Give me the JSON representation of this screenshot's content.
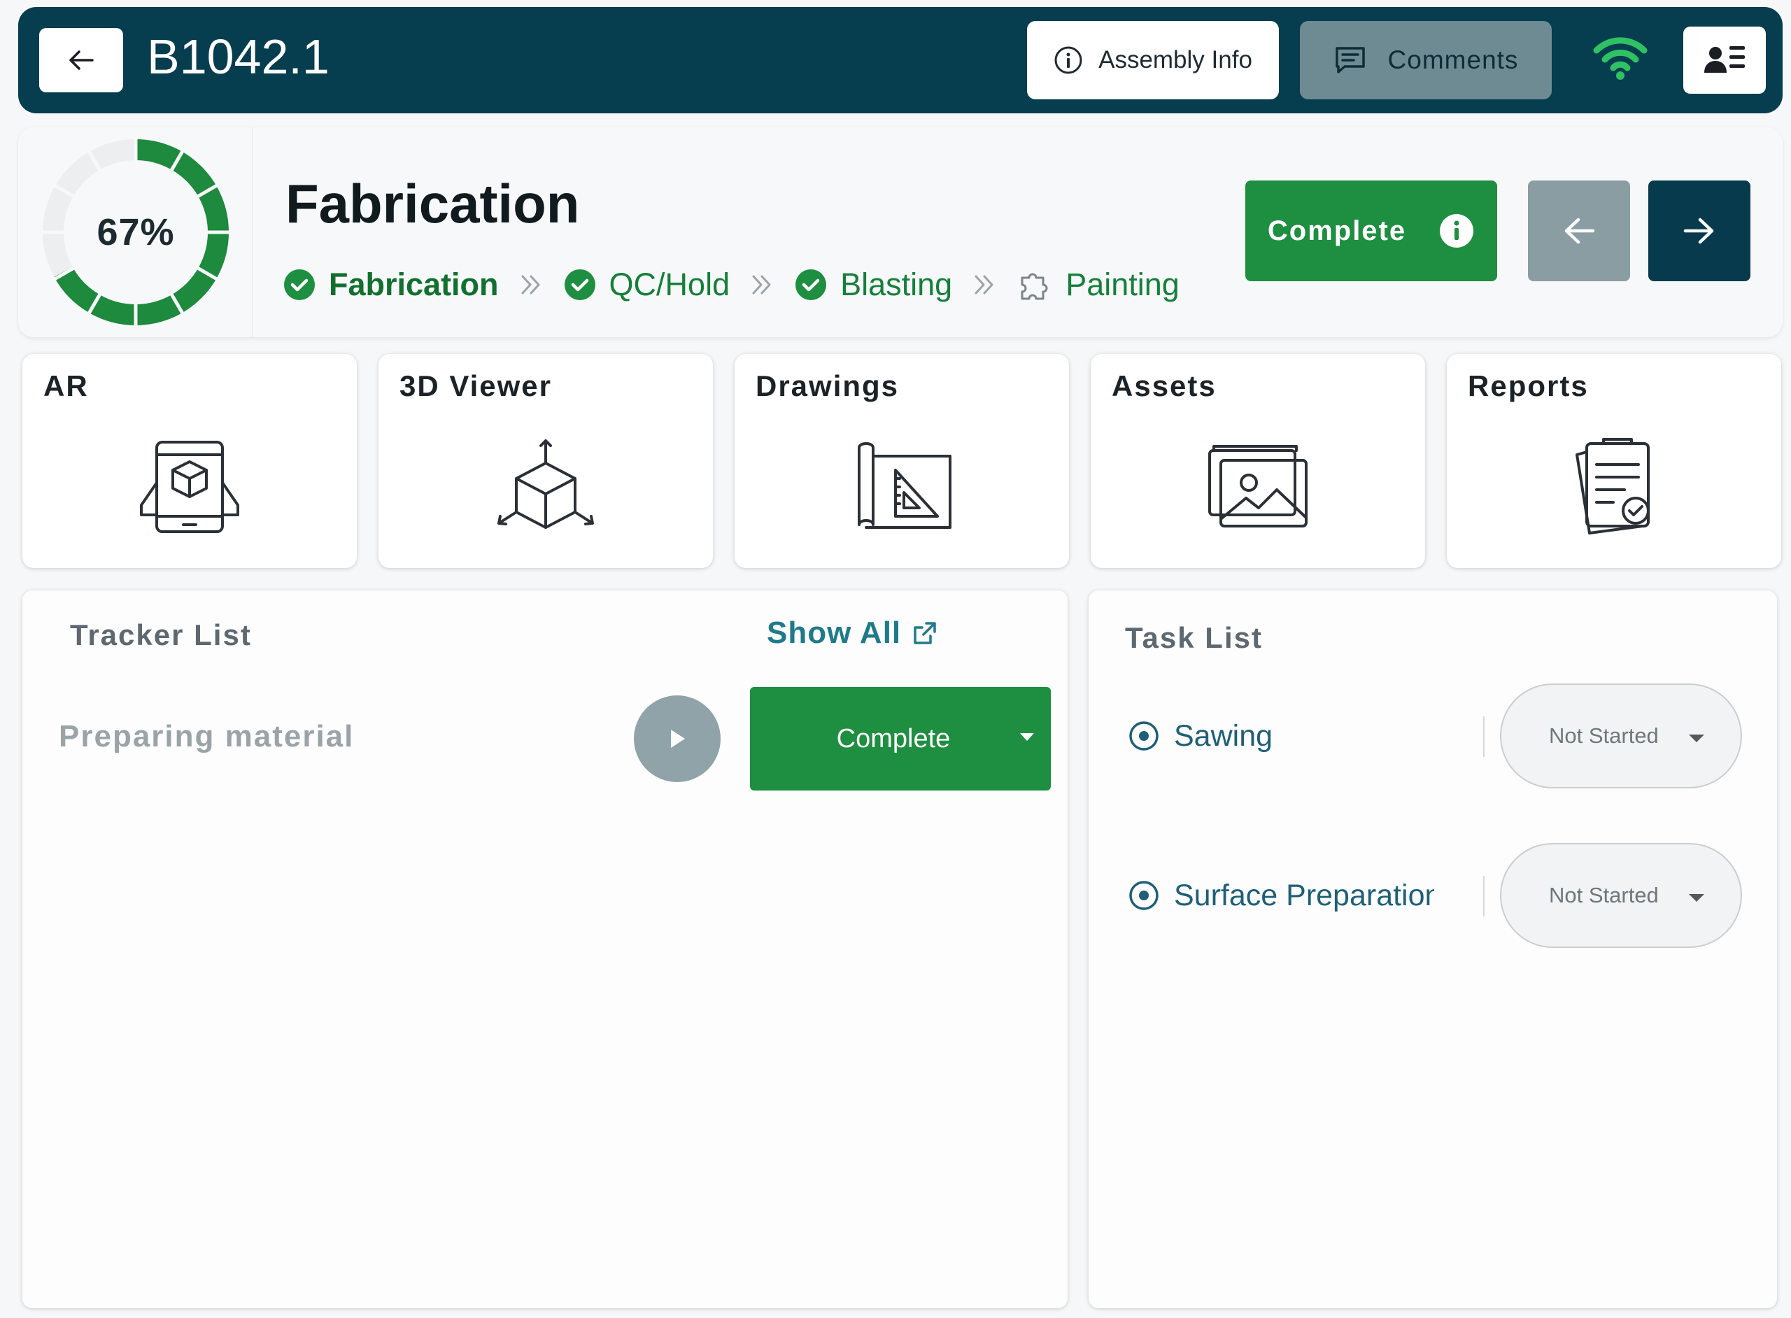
{
  "header": {
    "back_icon": "arrow-left-icon",
    "assembly_id": "B1042.1",
    "assembly_info_label": "Assembly Info",
    "comments_label": "Comments",
    "wifi_icon": "wifi-icon",
    "profile_icon": "user-list-icon"
  },
  "stage": {
    "progress_percent": 67,
    "progress_label": "67%",
    "title": "Fabrication",
    "steps": [
      {
        "label": "Fabrication",
        "status": "done",
        "current": true
      },
      {
        "label": "QC/Hold",
        "status": "done",
        "current": false
      },
      {
        "label": "Blasting",
        "status": "done",
        "current": false
      },
      {
        "label": "Painting",
        "status": "pending",
        "current": false
      }
    ],
    "complete_label": "Complete"
  },
  "cards": [
    {
      "title": "AR",
      "icon": "ar-tablet-cube-icon"
    },
    {
      "title": "3D Viewer",
      "icon": "3d-cube-icon"
    },
    {
      "title": "Drawings",
      "icon": "blueprint-icon"
    },
    {
      "title": "Assets",
      "icon": "image-stack-icon"
    },
    {
      "title": "Reports",
      "icon": "report-checklist-icon"
    }
  ],
  "tracker": {
    "title": "Tracker List",
    "show_all_label": "Show All",
    "items": [
      {
        "name": "Preparing material",
        "action_label": "Complete"
      }
    ]
  },
  "tasks": {
    "title": "Task List",
    "items": [
      {
        "name": "Sawing",
        "status": "Not Started"
      },
      {
        "name": "Surface Preparation",
        "status": "Not Started"
      }
    ]
  },
  "colors": {
    "header_bg": "#063d4f",
    "accent_green": "#1e8e40",
    "step_green": "#167f3a",
    "task_blue": "#1f5f77"
  }
}
